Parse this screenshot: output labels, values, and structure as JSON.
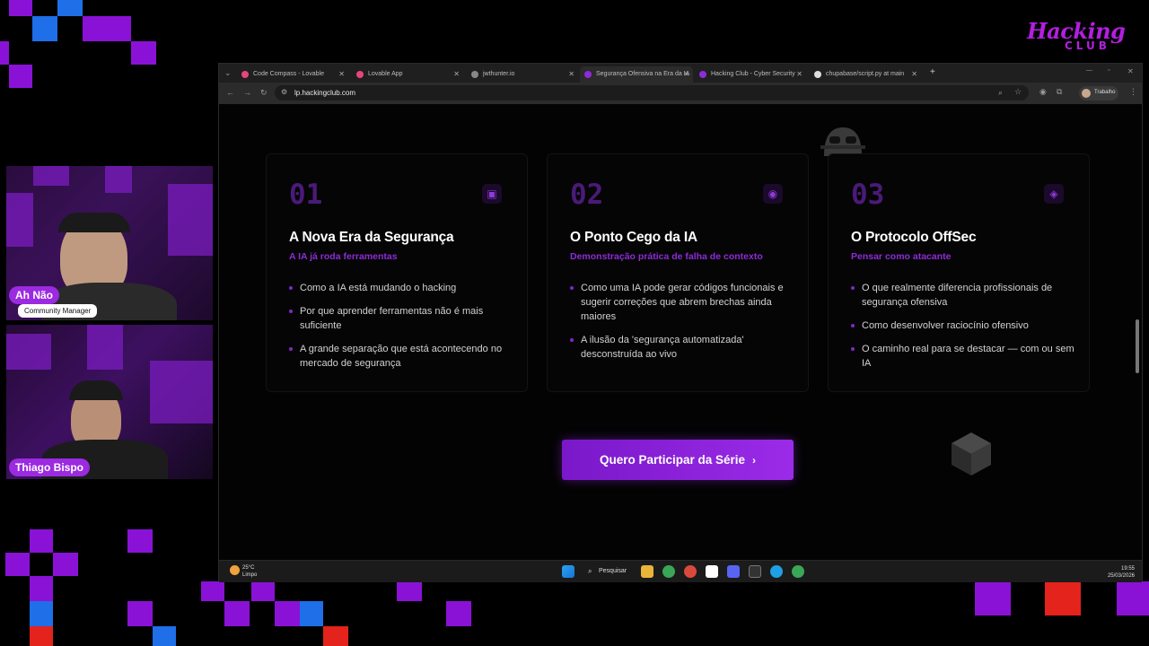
{
  "overlay": {
    "logo": {
      "line1": "Hacking",
      "line2": "CLUB"
    },
    "speakers": [
      {
        "name": "Ah Não",
        "role": "Community Manager"
      },
      {
        "name": "Thiago Bispo",
        "role": ""
      }
    ]
  },
  "browser": {
    "tabs": [
      {
        "label": "Code Compass - Lovable",
        "active": false
      },
      {
        "label": "Lovable App",
        "active": false
      },
      {
        "label": "jwthunter.io",
        "active": false
      },
      {
        "label": "Segurança Ofensiva na Era da IA",
        "active": true
      },
      {
        "label": "Hacking Club - Cyber Security",
        "active": false
      },
      {
        "label": "chupabase/script.py at main",
        "active": false
      }
    ],
    "url": "lp.hackingclub.com",
    "profile_label": "Trabalho"
  },
  "cards": [
    {
      "number": "01",
      "icon": "chip-icon",
      "title": "A Nova Era da Segurança",
      "subtitle": "A IA já roda ferramentas",
      "bullets": [
        "Como a IA está mudando o hacking",
        "Por que aprender ferramentas não é mais suficiente",
        "A grande separação que está acontecendo no mercado de segurança"
      ]
    },
    {
      "number": "02",
      "icon": "eye-icon",
      "title": "O Ponto Cego da IA",
      "subtitle": "Demonstração prática de falha de contexto",
      "bullets": [
        "Como uma IA pode gerar códigos funcionais e sugerir correções que abrem brechas ainda maiores",
        "A ilusão da 'segurança automatizada' desconstruída ao vivo"
      ]
    },
    {
      "number": "03",
      "icon": "compass-icon",
      "title": "O Protocolo OffSec",
      "subtitle": "Pensar como atacante",
      "bullets": [
        "O que realmente diferencia profissionais de segurança ofensiva",
        "Como desenvolver raciocínio ofensivo",
        "O caminho real para se destacar — com ou sem IA"
      ]
    }
  ],
  "cta": {
    "label": "Quero Participar da Série",
    "chevron": "›"
  },
  "taskbar": {
    "weather_temp": "25°C",
    "weather_desc": "Limpo",
    "search_label": "Pesquisar",
    "time": "19:55",
    "date": "25/03/2026"
  },
  "colors": {
    "accent": "#9b2be8",
    "number": "#4a1a78",
    "subtitle": "#8e2bd8",
    "background": "#030303"
  }
}
